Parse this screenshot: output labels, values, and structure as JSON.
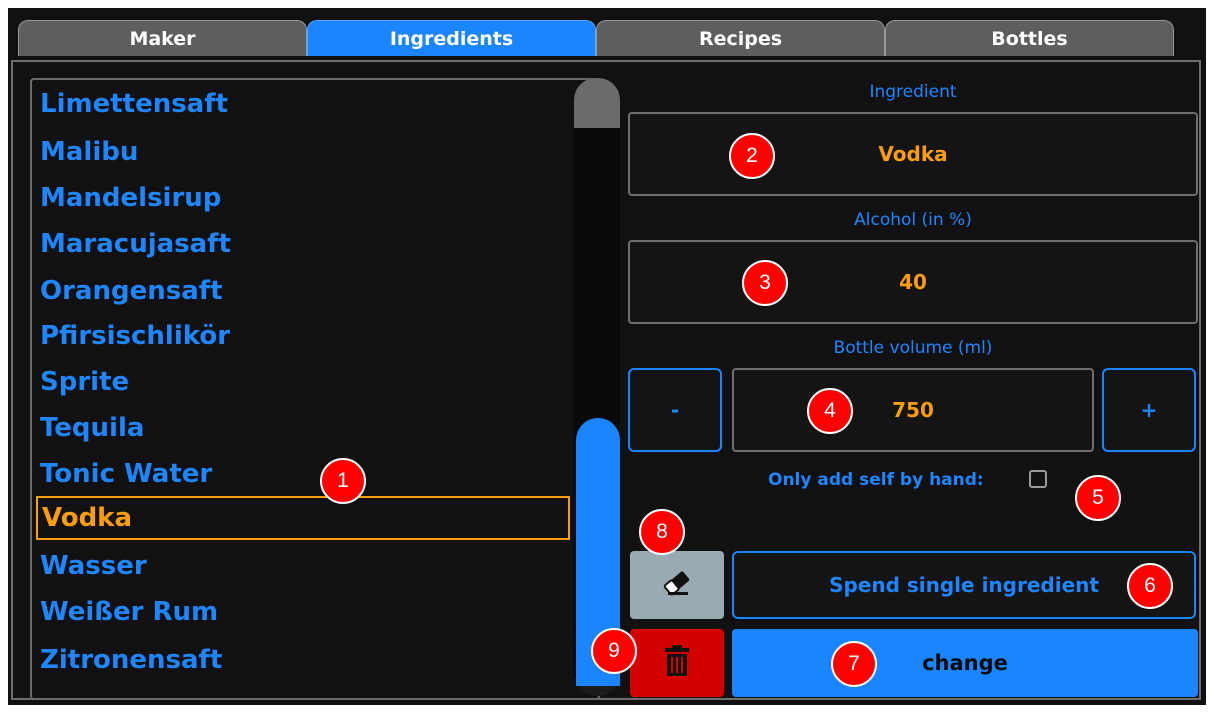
{
  "tabs": [
    {
      "label": "Maker"
    },
    {
      "label": "Ingredients"
    },
    {
      "label": "Recipes"
    },
    {
      "label": "Bottles"
    }
  ],
  "active_tab": "Ingredients",
  "ingredient_list": {
    "items": [
      "Limettensaft",
      "Malibu",
      "Mandelsirup",
      "Maracujasaft",
      "Orangensaft",
      "Pfirsischlikör",
      "Sprite",
      "Tequila",
      "Tonic Water",
      "Vodka",
      "Wasser",
      "Weißer Rum",
      "Zitronensaft"
    ],
    "selected": "Vodka"
  },
  "form": {
    "ingredient_label": "Ingredient",
    "ingredient_value": "Vodka",
    "alcohol_label": "Alcohol (in %)",
    "alcohol_value": "40",
    "volume_label": "Bottle volume (ml)",
    "volume_value": "750",
    "minus_label": "-",
    "plus_label": "+",
    "hand_label": "Only add self by hand:",
    "hand_checked": false
  },
  "buttons": {
    "spend_label": "Spend single ingredient",
    "change_label": "change",
    "eraser_icon": "eraser-icon",
    "trash_icon": "trash-icon"
  },
  "markers": [
    "1",
    "2",
    "3",
    "4",
    "5",
    "6",
    "7",
    "8",
    "9"
  ],
  "colors": {
    "accent": "#1a85ff",
    "value": "#ff9e0c",
    "background": "#111111",
    "delete": "#d40000",
    "clear": "#9aaab3",
    "marker": "#ff0000"
  }
}
